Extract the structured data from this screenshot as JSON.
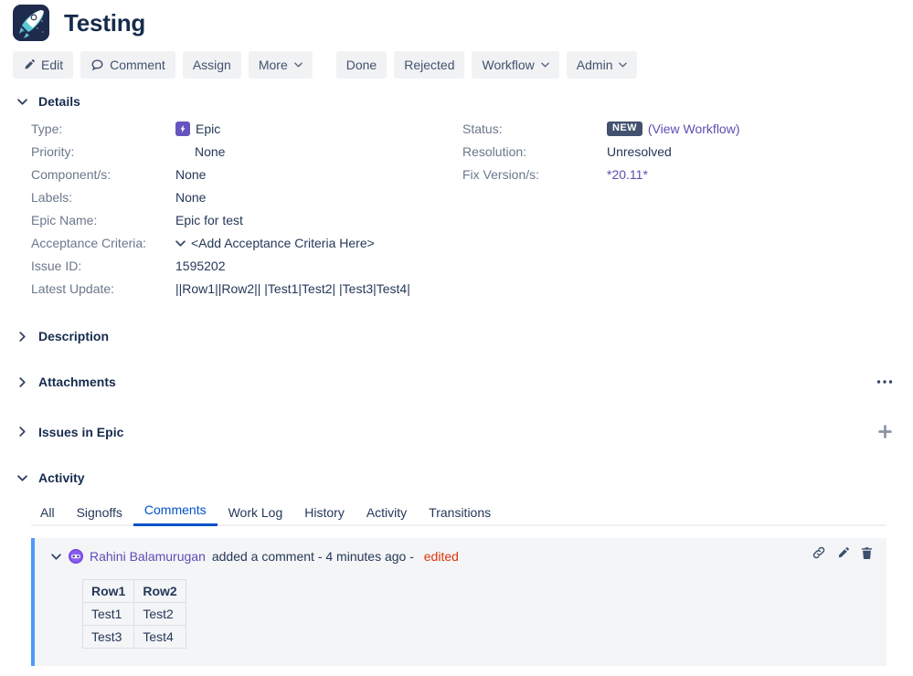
{
  "header": {
    "logo_icon": "rocket-icon",
    "title": "Testing"
  },
  "toolbar": {
    "edit_label": "Edit",
    "edit_icon": "pencil-icon",
    "comment_label": "Comment",
    "comment_icon": "speech-bubble-icon",
    "assign_label": "Assign",
    "more_label": "More",
    "more_caret": "⌄",
    "done_label": "Done",
    "rejected_label": "Rejected",
    "workflow_label": "Workflow",
    "workflow_caret": "⌄",
    "admin_label": "Admin",
    "admin_caret": "⌄"
  },
  "sections": {
    "details": "Details",
    "description": "Description",
    "attachments": "Attachments",
    "issues_in_epic": "Issues in Epic",
    "activity": "Activity"
  },
  "details": {
    "left": [
      {
        "label": "Type:",
        "value": "Epic",
        "icon": "epic-icon"
      },
      {
        "label": "Priority:",
        "value": "None",
        "indent": true
      },
      {
        "label": "Component/s:",
        "value": "None"
      },
      {
        "label": "Labels:",
        "value": "None"
      },
      {
        "label": "Epic Name:",
        "value": "Epic for test"
      },
      {
        "label": "Acceptance Criteria:",
        "value": "<Add Acceptance Criteria Here>",
        "chevron": true
      },
      {
        "label": "Issue ID:",
        "value": "1595202"
      },
      {
        "label": "Latest Update:",
        "value": "||Row1||Row2|| |Test1|Test2| |Test3|Test4|"
      }
    ],
    "right": [
      {
        "label": "Status:",
        "badge": "NEW",
        "link": "(View Workflow)"
      },
      {
        "label": "Resolution:",
        "value": "Unresolved"
      },
      {
        "label": "Fix Version/s:",
        "value": "*20.11*",
        "purple": true
      }
    ]
  },
  "activity": {
    "tabs": [
      {
        "label": "All",
        "active": false
      },
      {
        "label": "Signoffs",
        "active": false
      },
      {
        "label": "Comments",
        "active": true
      },
      {
        "label": "Work Log",
        "active": false
      },
      {
        "label": "History",
        "active": false
      },
      {
        "label": "Activity",
        "active": false
      },
      {
        "label": "Transitions",
        "active": false
      }
    ],
    "comment": {
      "author": "Rahini Balamurugan",
      "action_text": "added a comment - 4 minutes ago - ",
      "edited_label": "edited",
      "avatar_icon": "user-avatar",
      "actions": [
        "link-icon",
        "pencil-icon",
        "trash-icon"
      ],
      "table": {
        "headers": [
          "Row1",
          "Row2"
        ],
        "rows": [
          [
            "Test1",
            "Test2"
          ],
          [
            "Test3",
            "Test4"
          ]
        ]
      }
    }
  },
  "colors": {
    "accent_blue": "#0052cc",
    "epic_purple": "#6554c0",
    "link_purple": "#5e4db2",
    "edited_red": "#de350b",
    "badge_slate": "#42526e"
  }
}
